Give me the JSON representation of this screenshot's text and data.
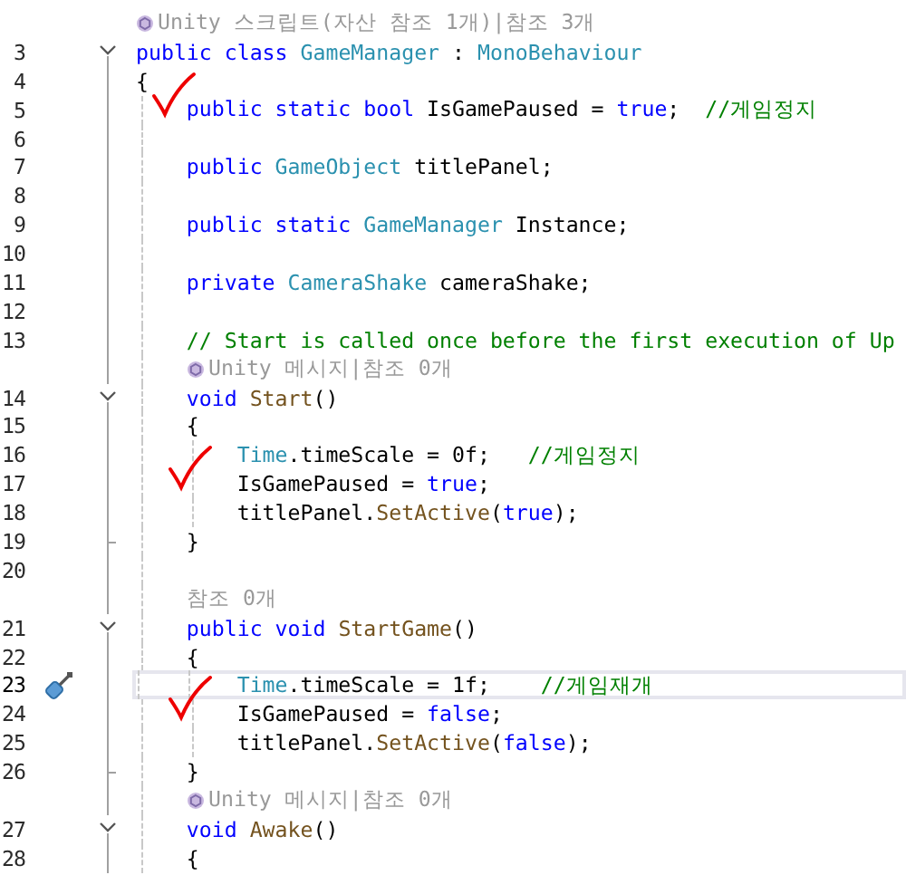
{
  "editor": {
    "rows": [
      {
        "kind": "lens",
        "unity_icon": true,
        "text": "Unity 스크립트(자산 참조 1개)|참조 3개"
      },
      {
        "kind": "code",
        "num": "3",
        "foldable": true,
        "tokens": [
          {
            "kind": "kw",
            "t": "public class "
          },
          {
            "kind": "type",
            "t": "GameManager"
          },
          {
            "kind": "plain",
            "t": " : "
          },
          {
            "kind": "type",
            "t": "MonoBehaviour"
          }
        ]
      },
      {
        "kind": "code",
        "num": "4",
        "tokens": [
          {
            "kind": "plain",
            "t": "{"
          }
        ]
      },
      {
        "kind": "code",
        "num": "5",
        "marked": true,
        "tokens": [
          {
            "kind": "kw",
            "t": "    public static bool"
          },
          {
            "kind": "plain",
            "t": " IsGamePaused = "
          },
          {
            "kind": "kw",
            "t": "true"
          },
          {
            "kind": "plain",
            "t": ";  "
          },
          {
            "kind": "comment",
            "t": "//게임정지"
          }
        ]
      },
      {
        "kind": "code",
        "num": "6",
        "tokens": []
      },
      {
        "kind": "code",
        "num": "7",
        "tokens": [
          {
            "kind": "kw",
            "t": "    public "
          },
          {
            "kind": "type",
            "t": "GameObject"
          },
          {
            "kind": "plain",
            "t": " titlePanel;"
          }
        ]
      },
      {
        "kind": "code",
        "num": "8",
        "tokens": []
      },
      {
        "kind": "code",
        "num": "9",
        "tokens": [
          {
            "kind": "kw",
            "t": "    public static "
          },
          {
            "kind": "type",
            "t": "GameManager"
          },
          {
            "kind": "plain",
            "t": " Instance;"
          }
        ]
      },
      {
        "kind": "code",
        "num": "10",
        "tokens": []
      },
      {
        "kind": "code",
        "num": "11",
        "tokens": [
          {
            "kind": "kw",
            "t": "    private "
          },
          {
            "kind": "type",
            "t": "CameraShake"
          },
          {
            "kind": "plain",
            "t": " cameraShake;"
          }
        ]
      },
      {
        "kind": "code",
        "num": "12",
        "tokens": []
      },
      {
        "kind": "code",
        "num": "13",
        "tokens": [
          {
            "kind": "comment",
            "t": "    // Start is called once before the first execution of Up"
          }
        ]
      },
      {
        "kind": "lens",
        "unity_icon": true,
        "text": "Unity 메시지|참조 0개"
      },
      {
        "kind": "code",
        "num": "14",
        "foldable": true,
        "tokens": [
          {
            "kind": "kw",
            "t": "    void "
          },
          {
            "kind": "method",
            "t": "Start"
          },
          {
            "kind": "plain",
            "t": "()"
          }
        ]
      },
      {
        "kind": "code",
        "num": "15",
        "tokens": [
          {
            "kind": "plain",
            "t": "    {"
          }
        ]
      },
      {
        "kind": "code",
        "num": "16",
        "tokens": [
          {
            "kind": "type",
            "t": "        Time"
          },
          {
            "kind": "plain",
            "t": ".timeScale = 0f;   "
          },
          {
            "kind": "comment",
            "t": "//게임정지"
          }
        ]
      },
      {
        "kind": "code",
        "num": "17",
        "marked": true,
        "tokens": [
          {
            "kind": "plain",
            "t": "        IsGamePaused = "
          },
          {
            "kind": "kw",
            "t": "true"
          },
          {
            "kind": "plain",
            "t": ";"
          }
        ]
      },
      {
        "kind": "code",
        "num": "18",
        "tokens": [
          {
            "kind": "plain",
            "t": "        titlePanel."
          },
          {
            "kind": "method",
            "t": "SetActive"
          },
          {
            "kind": "plain",
            "t": "("
          },
          {
            "kind": "kw",
            "t": "true"
          },
          {
            "kind": "plain",
            "t": ");"
          }
        ]
      },
      {
        "kind": "code",
        "num": "19",
        "block_end": true,
        "tokens": [
          {
            "kind": "plain",
            "t": "    }"
          }
        ]
      },
      {
        "kind": "code",
        "num": "20",
        "tokens": []
      },
      {
        "kind": "lens",
        "unity_icon": false,
        "text": "참조 0개"
      },
      {
        "kind": "code",
        "num": "21",
        "foldable": true,
        "tokens": [
          {
            "kind": "kw",
            "t": "    public void "
          },
          {
            "kind": "method",
            "t": "StartGame"
          },
          {
            "kind": "plain",
            "t": "()"
          }
        ]
      },
      {
        "kind": "code",
        "num": "22",
        "tokens": [
          {
            "kind": "plain",
            "t": "    {"
          }
        ]
      },
      {
        "kind": "code",
        "num": "23",
        "current": true,
        "quick_action": true,
        "tokens": [
          {
            "kind": "type",
            "t": "        Time"
          },
          {
            "kind": "plain",
            "t": ".timeScale = 1f;    "
          },
          {
            "kind": "comment",
            "t": "//게임재개"
          }
        ]
      },
      {
        "kind": "code",
        "num": "24",
        "marked": true,
        "tokens": [
          {
            "kind": "plain",
            "t": "        IsGamePaused = "
          },
          {
            "kind": "kw",
            "t": "false"
          },
          {
            "kind": "plain",
            "t": ";"
          }
        ]
      },
      {
        "kind": "code",
        "num": "25",
        "tokens": [
          {
            "kind": "plain",
            "t": "        titlePanel."
          },
          {
            "kind": "method",
            "t": "SetActive"
          },
          {
            "kind": "plain",
            "t": "("
          },
          {
            "kind": "kw",
            "t": "false"
          },
          {
            "kind": "plain",
            "t": ");"
          }
        ]
      },
      {
        "kind": "code",
        "num": "26",
        "block_end": true,
        "tokens": [
          {
            "kind": "plain",
            "t": "    }"
          }
        ]
      },
      {
        "kind": "lens",
        "unity_icon": true,
        "text": "Unity 메시지|참조 0개"
      },
      {
        "kind": "code",
        "num": "27",
        "foldable": true,
        "tokens": [
          {
            "kind": "kw",
            "t": "    void "
          },
          {
            "kind": "method",
            "t": "Awake"
          },
          {
            "kind": "plain",
            "t": "()"
          }
        ]
      },
      {
        "kind": "code",
        "num": "28",
        "tokens": [
          {
            "kind": "plain",
            "t": "    {"
          }
        ]
      }
    ]
  }
}
